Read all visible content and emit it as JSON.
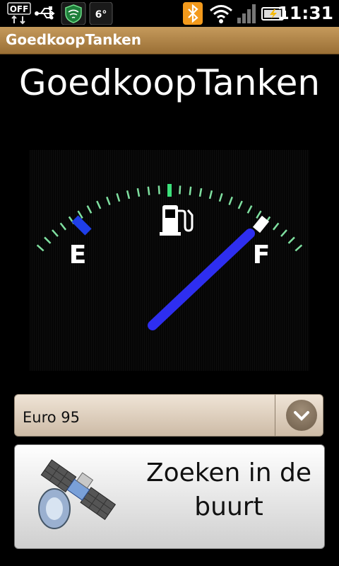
{
  "status_bar": {
    "time": "11:31",
    "temperature": "6°",
    "off_badge": "OFF",
    "icons": [
      "off-toggle-icon",
      "usb-icon",
      "shield-icon",
      "weather-icon",
      "bluetooth-icon",
      "wifi-icon",
      "signal-icon",
      "battery-icon"
    ]
  },
  "title_bar": {
    "title": "GoedkoopTanken"
  },
  "app": {
    "title": "GoedkoopTanken",
    "gauge": {
      "empty_label": "E",
      "full_label": "F",
      "level": 0.95
    },
    "fuel_select": {
      "selected": "Euro 95"
    },
    "search_button": {
      "label_line1": "Zoeken in de",
      "label_line2": "buurt"
    }
  },
  "colors": {
    "title_bar": "#b38546",
    "needle": "#2e2ef0",
    "gauge_tick": "#7fe0a0",
    "empty_mark": "#1f3fe8"
  }
}
